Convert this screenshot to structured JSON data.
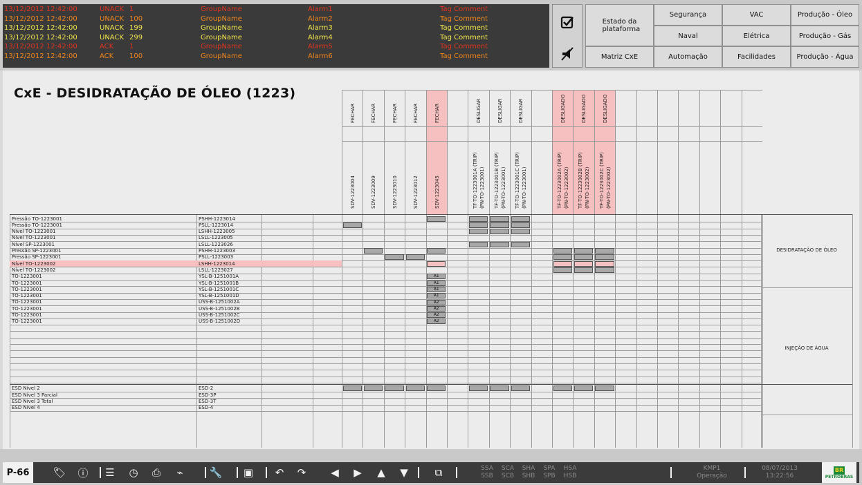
{
  "alarms": [
    {
      "time": "13/12/2012 12:42:00",
      "state": "UNACK",
      "priority": "1",
      "group": "GroupName",
      "alarm": "Alarm1",
      "comment": "Tag Comment",
      "severity": "red"
    },
    {
      "time": "13/12/2012 12:42:00",
      "state": "UNACK",
      "priority": "100",
      "group": "GroupName",
      "alarm": "Alarm2",
      "comment": "Tag Comment",
      "severity": "orange"
    },
    {
      "time": "13/12/2012 12:42:00",
      "state": "UNACK",
      "priority": "199",
      "group": "GroupName",
      "alarm": "Alarm3",
      "comment": "Tag Comment",
      "severity": "yellow"
    },
    {
      "time": "13/12/2012 12:42:00",
      "state": "UNACK",
      "priority": "299",
      "group": "GroupName",
      "alarm": "Alarm4",
      "comment": "Tag Comment",
      "severity": "yellow"
    },
    {
      "time": "13/12/2012 12:42:00",
      "state": "ACK",
      "priority": "1",
      "group": "GroupName",
      "alarm": "Alarm5",
      "comment": "Tag Comment",
      "severity": "red"
    },
    {
      "time": "13/12/2012 12:42:00",
      "state": "ACK",
      "priority": "100",
      "group": "GroupName",
      "alarm": "Alarm6",
      "comment": "Tag Comment",
      "severity": "orange"
    }
  ],
  "ack_buttons": {
    "ack_icon": "checkbox-check-icon",
    "silence_icon": "mute-horn-icon"
  },
  "nav": {
    "estado": "Estado da plataforma",
    "matriz": "Matriz CxE",
    "items": [
      [
        "Segurança",
        "VAC",
        "Produção - Óleo"
      ],
      [
        "Naval",
        "Elétrica",
        "Produção - Gás"
      ],
      [
        "Automação",
        "Facilidades",
        "Produção - Água"
      ]
    ]
  },
  "title": "CxE - DESIDRATAÇÃO DE ÓLEO (1223)",
  "columns": [
    {
      "action": "FECHAR",
      "tag": "SDV-1223004",
      "pink": false
    },
    {
      "action": "FECHAR",
      "tag": "SDV-1223009",
      "pink": false
    },
    {
      "action": "FECHAR",
      "tag": "SDV-1223010",
      "pink": false
    },
    {
      "action": "FECHAR",
      "tag": "SDV-1223012",
      "pink": false
    },
    {
      "action": "FECHAR",
      "tag": "SDV-1223045",
      "pink": true
    },
    {
      "action": "",
      "tag": "",
      "pink": false
    },
    {
      "action": "DESLIGAR",
      "tag": "TF-TO-1223001A (TRIP)|(PN-TO-1223001)",
      "pink": false
    },
    {
      "action": "DESLIGAR",
      "tag": "TF-TO-1223001B (TRIP)|(PN-TO-1223001)",
      "pink": false
    },
    {
      "action": "DESLIGAR",
      "tag": "TF-TO-1223001C (TRIP)|(PN-TO-1223001)",
      "pink": false
    },
    {
      "action": "",
      "tag": "",
      "pink": false
    },
    {
      "action": "DESLIGADO",
      "tag": "TF-TO-1223002A (TRIP)|(PN-TO-1223002)",
      "pink": true
    },
    {
      "action": "DESLIGADO",
      "tag": "TF-TO-1223002B (TRIP)|(PN-TO-1223002)",
      "pink": true
    },
    {
      "action": "DESLIGADO",
      "tag": "TF-TO-1223002C (TRIP)|(PN-TO-1223002)",
      "pink": true
    },
    {
      "action": "",
      "tag": "",
      "pink": false
    },
    {
      "action": "",
      "tag": "",
      "pink": false
    },
    {
      "action": "",
      "tag": "",
      "pink": false
    },
    {
      "action": "",
      "tag": "",
      "pink": false
    },
    {
      "action": "",
      "tag": "",
      "pink": false
    },
    {
      "action": "",
      "tag": "",
      "pink": false
    },
    {
      "action": "",
      "tag": "",
      "pink": false
    }
  ],
  "rows": [
    {
      "cause": "Pressão TO-1223001",
      "tag": "PSHH-1223014",
      "pink": false,
      "cells": {
        "4": "d",
        "6": "d",
        "7": "d",
        "8": "d"
      }
    },
    {
      "cause": "Pressão TO-1223001",
      "tag": "PSLL-1223014",
      "pink": false,
      "cells": {
        "0": "d",
        "6": "d",
        "7": "d",
        "8": "d"
      }
    },
    {
      "cause": "Nível TO-1223001",
      "tag": "LSHH-1223005",
      "pink": false,
      "cells": {
        "6": "d",
        "7": "d",
        "8": "d"
      }
    },
    {
      "cause": "Nível TO-1223001",
      "tag": "LSLL-1223005",
      "pink": false,
      "cells": {}
    },
    {
      "cause": "Nível SP-1223001",
      "tag": "LSLL-1223026",
      "pink": false,
      "cells": {
        "6": "d",
        "7": "d",
        "8": "d"
      }
    },
    {
      "cause": "Pressão SP-1223001",
      "tag": "PSHH-1223003",
      "pink": false,
      "cells": {
        "1": "d",
        "4": "d",
        "10": "d",
        "11": "d",
        "12": "d"
      }
    },
    {
      "cause": "Pressão SP-1223001",
      "tag": "PSLL-1223003",
      "pink": false,
      "cells": {
        "2": "d",
        "3": "d",
        "10": "d",
        "11": "d",
        "12": "d"
      }
    },
    {
      "cause": "Nível TO-1223002",
      "tag": "LSHH-1223014",
      "pink": true,
      "cells": {
        "4": "p",
        "10": "p",
        "11": "p",
        "12": "p"
      }
    },
    {
      "cause": "Nível TO-1223002",
      "tag": "LSLL-1223027",
      "pink": false,
      "cells": {
        "10": "d",
        "11": "d",
        "12": "d"
      }
    },
    {
      "cause": "TO-1223001",
      "tag": "YSL-B-1251001A",
      "pink": false,
      "cells": {
        "4": "A1"
      }
    },
    {
      "cause": "TO-1223001",
      "tag": "YSL-B-1251001B",
      "pink": false,
      "cells": {
        "4": "A1"
      }
    },
    {
      "cause": "TO-1223001",
      "tag": "YSL-B-1251001C",
      "pink": false,
      "cells": {
        "4": "A1"
      }
    },
    {
      "cause": "TO-1223001",
      "tag": "YSL-B-1251001D",
      "pink": false,
      "cells": {
        "4": "A1"
      }
    },
    {
      "cause": "TO-1223001",
      "tag": "USS-B-1251002A",
      "pink": false,
      "cells": {
        "4": "A2"
      }
    },
    {
      "cause": "TO-1223001",
      "tag": "USS-B-1251002B",
      "pink": false,
      "cells": {
        "4": "A2"
      }
    },
    {
      "cause": "TO-1223001",
      "tag": "USS-B-1251002C",
      "pink": false,
      "cells": {
        "4": "A2"
      }
    },
    {
      "cause": "TO-1223001",
      "tag": "USS-B-1251002D",
      "pink": false,
      "cells": {
        "4": "A2"
      }
    }
  ],
  "esd_rows": [
    {
      "cause": "ESD Nível 2",
      "tag": "ESD-2",
      "cells": {
        "0": "d",
        "1": "d",
        "2": "d",
        "3": "d",
        "4": "d",
        "6": "d",
        "7": "d",
        "8": "d",
        "10": "d",
        "11": "d",
        "12": "d"
      }
    },
    {
      "cause": "ESD Nível 3 Parcial",
      "tag": "ESD-3P",
      "cells": {}
    },
    {
      "cause": "ESD Nível 3 Total",
      "tag": "ESD-3T",
      "cells": {}
    },
    {
      "cause": "ESD Nível 4",
      "tag": "ESD-4",
      "cells": {}
    }
  ],
  "groups": {
    "g1": "DESIDRATAÇÃO DE ÓLEO",
    "g2": "INJEÇÃO DE ÁGUA"
  },
  "toolbar": {
    "platform": "P-66",
    "icons": [
      "tag-icon",
      "info-icon",
      "list-icon",
      "clock-icon",
      "print-icon",
      "trend-icon",
      "wrench-icon",
      "camera-icon",
      "undo-icon",
      "redo-icon",
      "prev-icon",
      "next-icon",
      "up-icon",
      "down-icon",
      "window-icon"
    ],
    "status": [
      [
        "SSA",
        "SSB"
      ],
      [
        "SCA",
        "SCB"
      ],
      [
        "SHA",
        "SHB"
      ],
      [
        "SPA",
        "SPB"
      ],
      [
        "HSA",
        "HSB"
      ]
    ],
    "user": "KMP1",
    "role": "Operação",
    "date": "08/07/2013",
    "time": "13:22:56",
    "logo": "PETROBRAS",
    "logo_short": "BR"
  },
  "colors": {
    "red": "#e0341f",
    "yellow": "#f1e44a",
    "orange": "#f2851c",
    "pink": "#f7c0c0"
  }
}
